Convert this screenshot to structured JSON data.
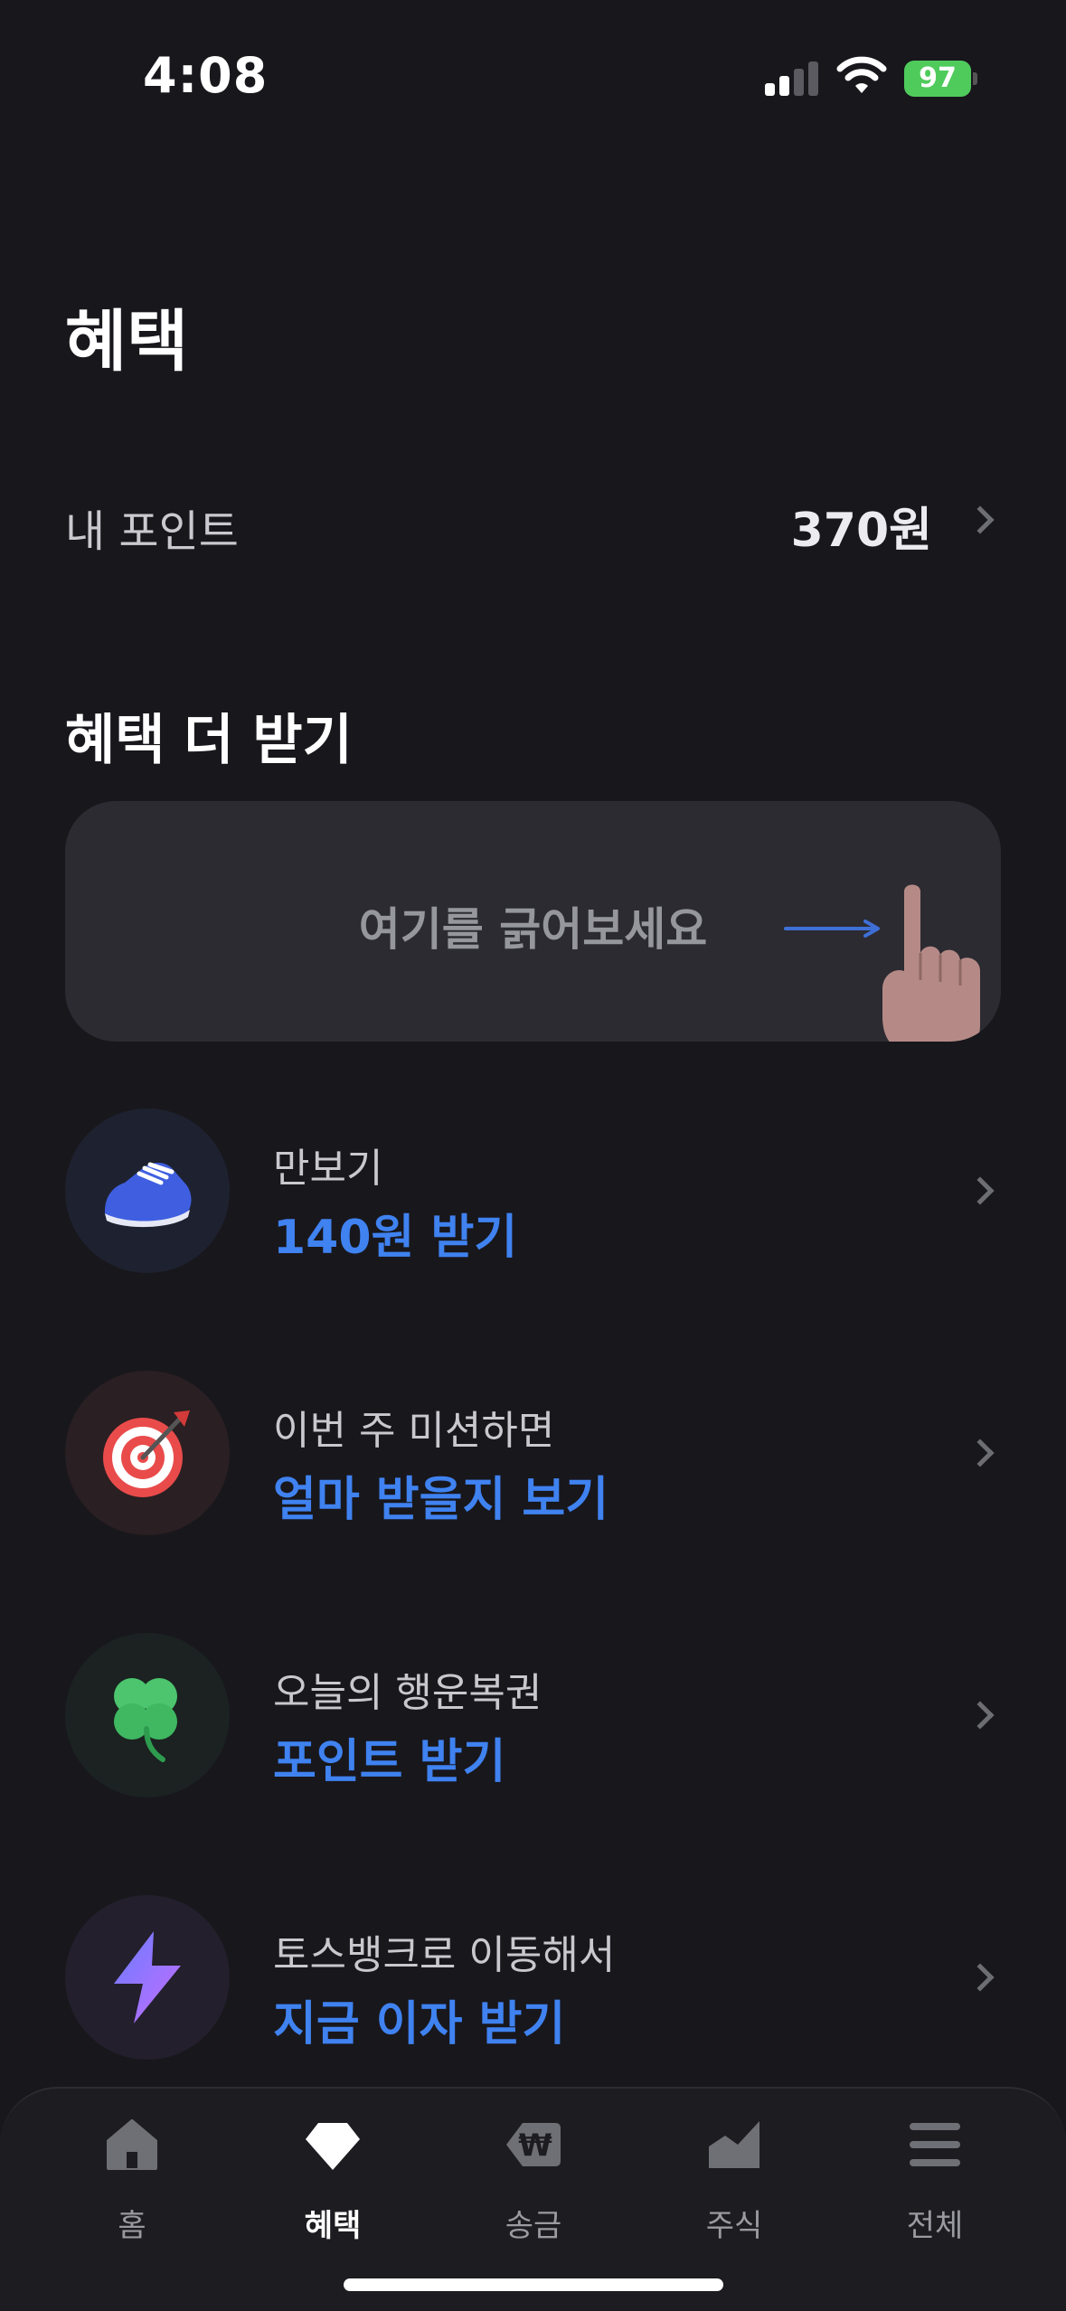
{
  "status_bar": {
    "time": "4:08",
    "battery": "97"
  },
  "header": {
    "title": "혜택"
  },
  "points": {
    "label": "내 포인트",
    "value": "370원"
  },
  "section": {
    "title": "혜택 더 받기"
  },
  "scratch": {
    "text": "여기를 긁어보세요"
  },
  "benefits": [
    {
      "subtitle": "만보기",
      "action": "140원 받기",
      "icon": "sneaker-icon"
    },
    {
      "subtitle": "이번 주 미션하면",
      "action": "얼마 받을지 보기",
      "icon": "target-icon"
    },
    {
      "subtitle": "오늘의 행운복권",
      "action": "포인트 받기",
      "icon": "clover-icon"
    },
    {
      "subtitle": "토스뱅크로 이동해서",
      "action": "지금 이자 받기",
      "icon": "lightning-icon"
    }
  ],
  "nav": [
    {
      "label": "홈",
      "icon": "home-icon"
    },
    {
      "label": "혜택",
      "icon": "diamond-icon",
      "active": true
    },
    {
      "label": "송금",
      "icon": "won-icon"
    },
    {
      "label": "주식",
      "icon": "chart-icon"
    },
    {
      "label": "전체",
      "icon": "menu-icon"
    }
  ],
  "colors": {
    "background": "#18171c",
    "accent": "#3f82f0",
    "card": "#2c2b32",
    "battery": "#4fcb5c"
  }
}
